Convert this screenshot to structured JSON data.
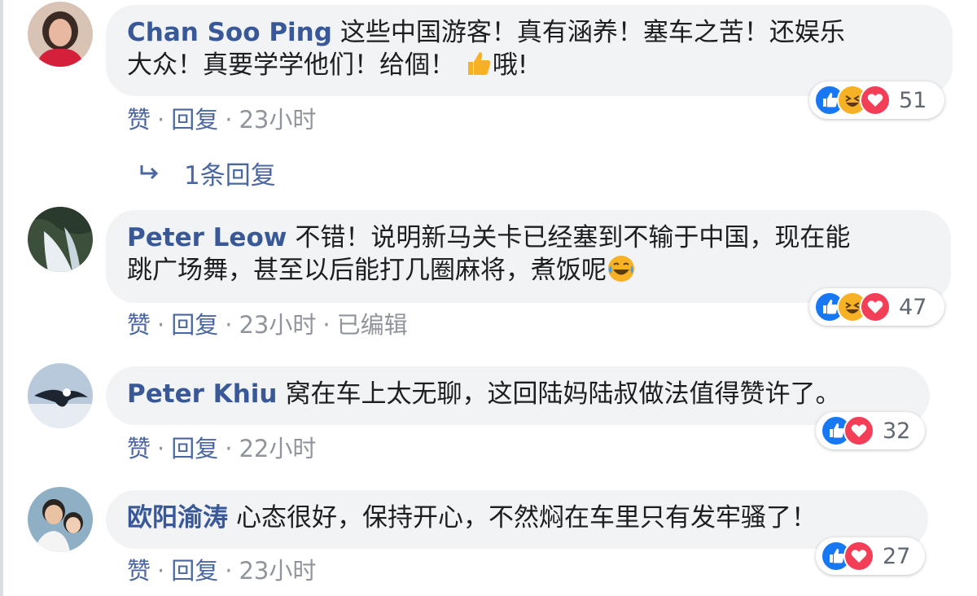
{
  "comments": [
    {
      "author": "Chan Soo Ping",
      "text_part1": "这些中国游客！真有涵养！塞车之苦！还娱乐",
      "text_part2a": "大众！真要学学他们！给個！",
      "text_part2b": "哦!",
      "inline_emoji": "thumbs-up",
      "like_label": "赞",
      "reply_label": "回复",
      "time": "23小时",
      "reaction_icons": [
        "like",
        "haha",
        "love"
      ],
      "reaction_count": "51"
    },
    {
      "author": "Peter Leow",
      "text_part1": "不错！说明新马关卡已经塞到不输于中国，现在能",
      "text_part2a": "跳广场舞，甚至以后能打几圈麻将，煮饭呢",
      "inline_emoji": "tears-of-joy",
      "like_label": "赞",
      "reply_label": "回复",
      "time": "23小时",
      "edited": "已编辑",
      "reaction_icons": [
        "like",
        "haha",
        "love"
      ],
      "reaction_count": "47"
    },
    {
      "author": "Peter Khiu",
      "text_part1": "窝在车上太无聊，这回陆妈陆叔做法值得赞许了。",
      "like_label": "赞",
      "reply_label": "回复",
      "time": "22小时",
      "reaction_icons": [
        "like",
        "love"
      ],
      "reaction_count": "32"
    },
    {
      "author": "欧阳渝涛",
      "text_part1": "心态很好，保持开心，不然焖在车里只有发牢骚了！",
      "like_label": "赞",
      "reply_label": "回复",
      "time": "23小时",
      "reaction_icons": [
        "like",
        "love"
      ],
      "reaction_count": "27"
    }
  ],
  "replies_link": "1条回复",
  "colors": {
    "author": "#385898",
    "bubble": "#f2f3f5",
    "like_blue": "#1877f2",
    "love_red": "#f33e58",
    "haha_yellow": "#f7b125"
  }
}
